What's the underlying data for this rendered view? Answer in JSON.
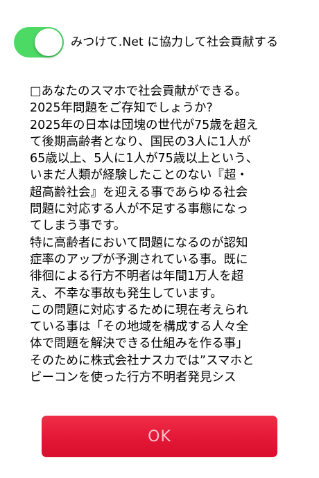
{
  "toggle": {
    "label": "みつけて.Net に協力して社会貢献する",
    "on": true,
    "on_color": "#4cd964"
  },
  "notice": {
    "lines": [
      "□あなたのスマホで社会貢献ができる。",
      "2025年問題をご存知でしょうか?",
      "2025年の日本は団塊の世代が75歳を超え",
      "て後期高齢者となり、国民の3人に1人が",
      "65歳以上、5人に1人が75歳以上という、",
      "いまだ人類が経験したことのない『超・",
      "超高齢社会』を迎える事であらゆる社会",
      "問題に対応する人が不足する事態になっ",
      "てしまう事です。",
      "特に高齢者において問題になるのが認知",
      "症率のアップが予測されている事。既に",
      "徘徊による行方不明者は年間1万人を超",
      "え、不幸な事故も発生しています。",
      "この問題に対応するために現在考えられ",
      "ている事は「その地域を構成する人々全",
      "体で問題を解決できる仕組みを作る事」",
      "そのために株式会社ナスカでは”スマホと",
      "ビーコンを使った行方不明者発見シス"
    ]
  },
  "ok_button": {
    "label": "OK",
    "color": "#e31736"
  }
}
